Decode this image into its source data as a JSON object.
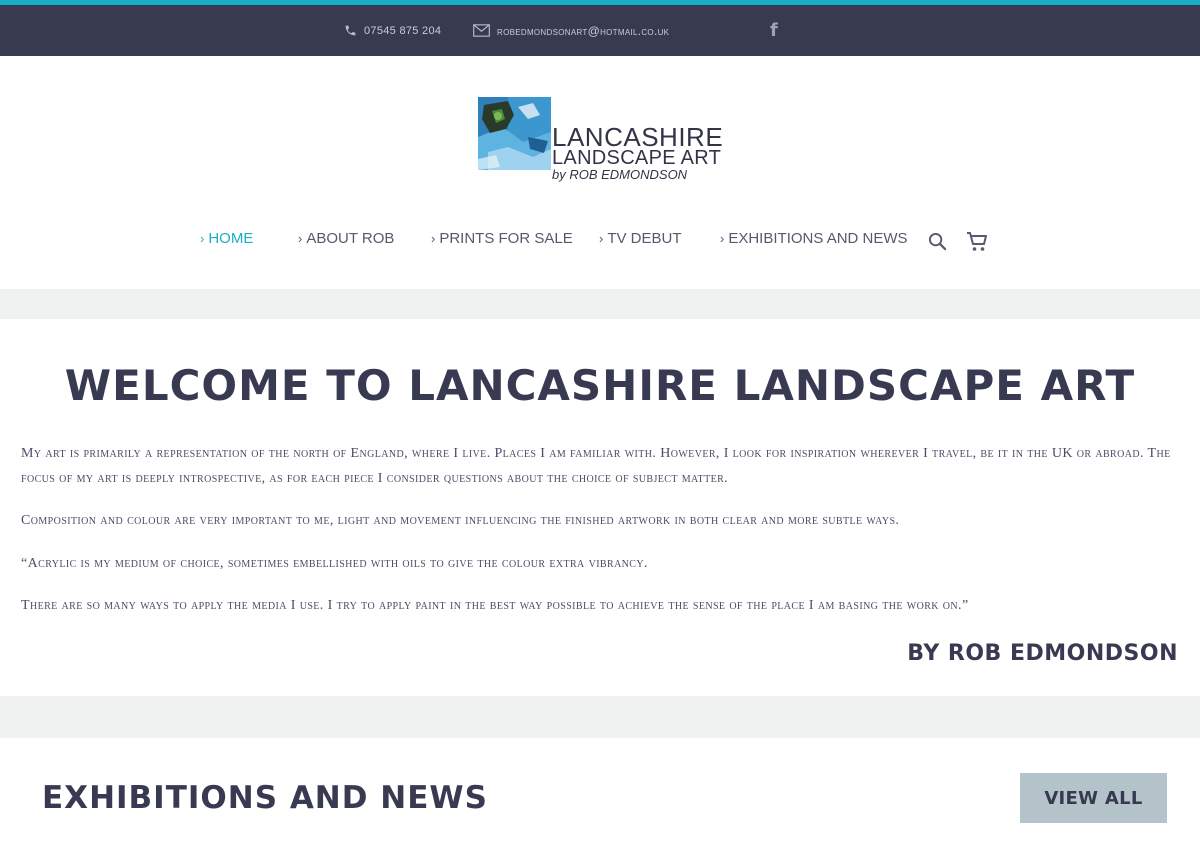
{
  "colors": {
    "accent": "#1aaec6",
    "topbar": "#383a50",
    "heading": "#383a52",
    "band": "#f0f2f1",
    "button": "#b4c2c9"
  },
  "topbar": {
    "phone": "07545 875 204",
    "email": "ROBEDMONDSONART@HOTMAIL.CO.UK",
    "facebook_icon": "facebook-icon"
  },
  "logo": {
    "line1": "LANCASHIRE",
    "line2": "LANDSCAPE ART",
    "line3": "by ROB EDMONDSON"
  },
  "nav": {
    "items": [
      {
        "label": "HOME",
        "active": true
      },
      {
        "label": "ABOUT ROB"
      },
      {
        "label": "PRINTS FOR SALE"
      },
      {
        "label": "TV DEBUT"
      },
      {
        "label": "EXHIBITIONS AND NEWS"
      }
    ],
    "search_icon": "search-icon",
    "cart_icon": "cart-icon"
  },
  "welcome": {
    "title": "WELCOME TO LANCASHIRE LANDSCAPE ART",
    "paragraphs": [
      "My art is primarily a representation of the north of England, where I live. Places I am familiar with. However, I look for inspiration wherever I travel, be it in the UK or abroad. The focus of my art is deeply introspective, as for each piece I consider questions about the choice of subject matter.",
      "Composition and colour are very important to me, light and movement influencing the finished artwork in both clear and more subtle ways.",
      "“Acrylic is my medium of choice, sometimes embellished with oils to give the colour extra vibrancy.",
      "There are so many ways to apply the media I use. I try to apply paint in the best way possible to achieve the sense of the place I am basing the work on.”"
    ],
    "byline": "BY ROB EDMONDSON"
  },
  "news": {
    "title": "EXHIBITIONS AND NEWS",
    "button": "VIEW ALL"
  }
}
